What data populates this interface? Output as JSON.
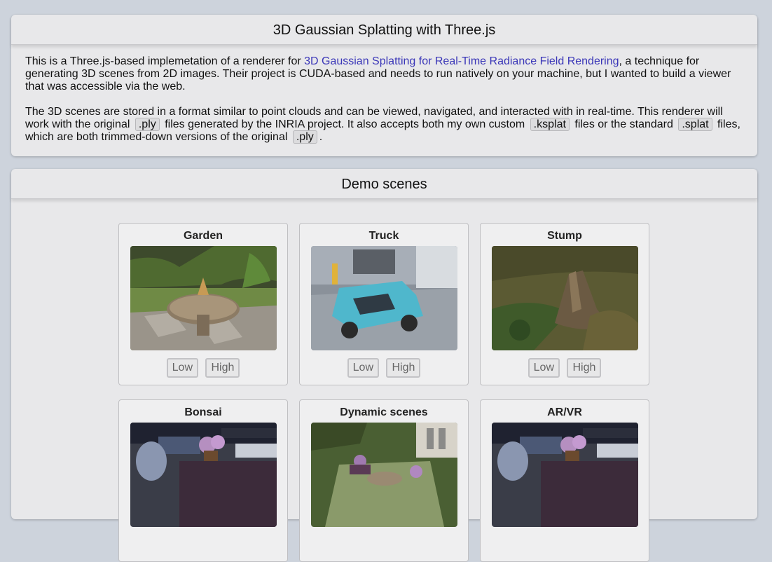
{
  "intro": {
    "title": "3D Gaussian Splatting with Three.js",
    "p1_before": "This is a Three.js-based implemetation of a renderer for ",
    "p1_link": "3D Gaussian Splatting for Real-Time Radiance Field Rendering",
    "p1_after": ", a technique for generating 3D scenes from 2D images. Their project is CUDA-based and needs to run natively on your machine, but I wanted to build a viewer that was accessible via the web.",
    "p2_a": "The 3D scenes are stored in a format similar to point clouds and can be viewed, navigated, and interacted with in real-time. This renderer will work with the original ",
    "p2_code1": ".ply",
    "p2_b": " files generated by the INRIA project. It also accepts both my own custom ",
    "p2_code2": ".ksplat",
    "p2_c": " files or the standard ",
    "p2_code3": ".splat",
    "p2_d": " files, which are both trimmed-down versions of the original ",
    "p2_code4": ".ply",
    "p2_e": "."
  },
  "demos": {
    "title": "Demo scenes",
    "cards": [
      {
        "title": "Garden",
        "low": "Low",
        "high": "High"
      },
      {
        "title": "Truck",
        "low": "Low",
        "high": "High"
      },
      {
        "title": "Stump",
        "low": "Low",
        "high": "High"
      },
      {
        "title": "Bonsai"
      },
      {
        "title": "Dynamic scenes"
      },
      {
        "title": "AR/VR"
      }
    ]
  },
  "colors": {
    "page_bg": "#cdd3dc",
    "panel_bg": "#e8e8ea",
    "link": "#3a36b8"
  }
}
